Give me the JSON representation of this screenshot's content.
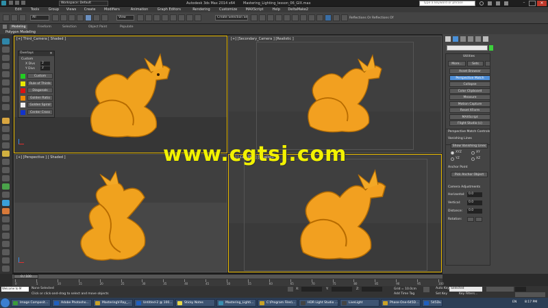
{
  "window": {
    "title": "Autodesk 3ds Max 2014 x64",
    "file": "Mastering_Lighting_lesson_06_GIX.max",
    "workspace": "Workspace: Default",
    "search_placeholder": "Type a keyword or phrase"
  },
  "menu": [
    "Edit",
    "Tools",
    "Group",
    "Views",
    "Create",
    "Modifiers",
    "Animation",
    "Graph Editors",
    "Rendering",
    "Customize",
    "MAXScript",
    "Help",
    "DeltaMake2"
  ],
  "toolbar": {
    "filter": "All",
    "view": "View",
    "selection_set": "Create Selection Se",
    "ref_label": "Reflections Or Reflections Of"
  },
  "ribbon": {
    "tabs": [
      "Modeling",
      "Freeform",
      "Selection",
      "Object Paint",
      "Populate"
    ],
    "sub": "Polygon Modeling"
  },
  "viewports": [
    {
      "label": "[+] Third_Camera [ Shaded ]"
    },
    {
      "label": "[+] [Secondary_Camera ] [Realistic ]"
    },
    {
      "label": "[+] [Perspective ] [ Shaded ]"
    },
    {
      "label": "[+] [ Cam001 ] [ Realistic ]"
    }
  ],
  "overlay": {
    "title": "Overlays",
    "custom": "Custom",
    "x_divs_label": "X Divs",
    "y_divs_label": "Y Divs",
    "x_divs": "2",
    "y_divs": "2",
    "options": [
      {
        "label": "Custom",
        "color": "#22cc22"
      },
      {
        "label": "Rule of Thirds",
        "color": "#e8e800"
      },
      {
        "label": "Diagonals",
        "color": "#dd1111"
      },
      {
        "label": "Golden Ratio",
        "color": "#ee8800"
      },
      {
        "label": "Golden Spiral",
        "color": "#eeeeee"
      },
      {
        "label": "Center Cross",
        "color": "#1133cc"
      }
    ]
  },
  "watermark": "www.cgtsj.com",
  "right_panel": {
    "utilities_title": "Utilities",
    "more": "More...",
    "sets": "Sets",
    "utilities": [
      "Asset Browser",
      "Perspective Match",
      "Collapse",
      "Color Clipboard",
      "Measure",
      "Motion Capture",
      "Reset XForm",
      "MAXScript",
      "Flight Studio (c)"
    ],
    "pm_title": "Perspective Match Controls",
    "vanishing_lines": "Vanishing Lines",
    "show_vanishing": "Show Vanishing Lines",
    "radios": [
      "XYZ",
      "XY",
      "YZ",
      "XZ"
    ],
    "anchor_point": "Anchor Point",
    "pick_anchor": "Pick Anchor Object",
    "camera_adj": "Camera Adjustments",
    "horizontal": "Horizontal:",
    "vertical": "Vertical:",
    "distance": "Distance:",
    "rotation": "Rotation:",
    "zero": "0.0"
  },
  "timeline": {
    "frame": "0 / 100",
    "ticks": [
      "0",
      "5",
      "10",
      "15",
      "20",
      "25",
      "30",
      "35",
      "40",
      "45",
      "50",
      "55",
      "60",
      "65",
      "70",
      "75",
      "80",
      "85",
      "90",
      "95",
      "100"
    ]
  },
  "status": {
    "selected": "None Selected",
    "prompt": "Click or click-and-drag to select and move objects",
    "x_label": "X:",
    "y_label": "Y:",
    "z_label": "Z:",
    "grid": "Grid = 10.0cm",
    "auto_key": "Auto Key",
    "set_key": "Set Key",
    "selected_dd": "Selected",
    "key_filters": "Key Filters...",
    "add_time_tag": "Add Time Tag",
    "welcome": "Welcome to M"
  },
  "taskbar": {
    "tasks": [
      {
        "label": "Image Composit...",
        "color": "#3a9a3a"
      },
      {
        "label": "Adobe Photosho...",
        "color": "#1f5fbf"
      },
      {
        "label": "MasteringV-Ray_...",
        "color": "#c9a227"
      },
      {
        "label": "Untitled-2 @ 100...",
        "color": "#1f5fbf"
      },
      {
        "label": "Sticky Notes",
        "color": "#e8d84a"
      },
      {
        "label": "Mastering_Lighti...",
        "color": "#3a8fb0"
      },
      {
        "label": "C:\\Program Files\\...",
        "color": "#c9a227"
      },
      {
        "label": "HDR Light Studio ...",
        "color": "#444444"
      },
      {
        "label": "LiveLight",
        "color": "#444444"
      },
      {
        "label": "Phase-One-645D...",
        "color": "#c9a227"
      },
      {
        "label": "545Dv...",
        "color": "#1f5fbf"
      }
    ],
    "lang": "EN",
    "time": "8:17 PM"
  }
}
